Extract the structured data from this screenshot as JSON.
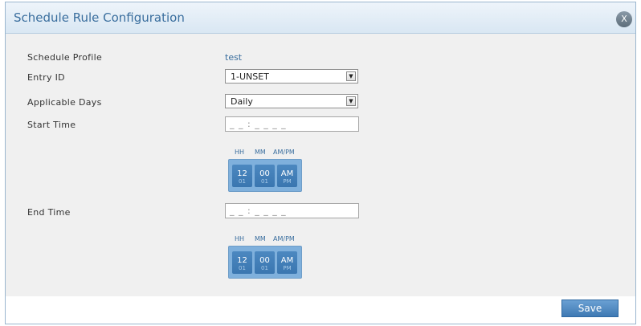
{
  "dialog": {
    "title": "Schedule Rule Configuration",
    "close_label": "X",
    "save_label": "Save"
  },
  "fields": {
    "schedule_profile": {
      "label": "Schedule Profile",
      "value": "test"
    },
    "entry_id": {
      "label": "Entry ID",
      "selected": "1-UNSET"
    },
    "applicable_days": {
      "label": "Applicable Days",
      "selected": "Daily"
    },
    "start_time": {
      "label": "Start Time",
      "value": "_ _ : _ _  _ _"
    },
    "end_time": {
      "label": "End Time",
      "value": "_ _ : _ _  _ _"
    }
  },
  "picker": {
    "headers": {
      "hh": "HH",
      "mm": "MM",
      "ampm": "AM/PM"
    },
    "start": {
      "hh": "12",
      "hh_next": "01",
      "mm": "00",
      "mm_next": "01",
      "ampm": "AM",
      "ampm_next": "PM"
    },
    "end": {
      "hh": "12",
      "hh_next": "01",
      "mm": "00",
      "mm_next": "01",
      "ampm": "AM",
      "ampm_next": "PM"
    }
  },
  "colors": {
    "accent": "#3a6e9e",
    "button": "#4a84be",
    "panel_bg": "#f0f0f0"
  }
}
